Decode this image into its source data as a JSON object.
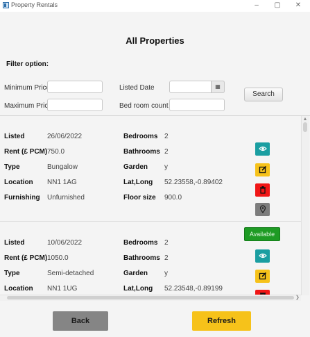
{
  "window": {
    "title": "Property Rentals",
    "min_glyph": "–",
    "max_glyph": "▢",
    "close_glyph": "✕"
  },
  "page": {
    "title": "All Properties",
    "filter_label": "Filter option:"
  },
  "filters": {
    "min_price_label": "Minimum Price",
    "max_price_label": "Maximum Price",
    "listed_date_label": "Listed Date",
    "bedroom_count_label": "Bed room count",
    "min_price_value": "",
    "max_price_value": "",
    "listed_date_value": "",
    "bedroom_count_value": "",
    "calendar_icon": "calendar-icon",
    "search_label": "Search"
  },
  "labels": {
    "listed": "Listed",
    "rent": "Rent (£ PCM)",
    "type": "Type",
    "location": "Location",
    "furnishing": "Furnishing",
    "bedrooms": "Bedrooms",
    "bathrooms": "Bathrooms",
    "garden": "Garden",
    "latlong": "Lat,Long",
    "floor_size": "Floor size"
  },
  "properties": [
    {
      "listed": "26/06/2022",
      "rent": "750.0",
      "type": "Bungalow",
      "location": "NN1 1AG",
      "furnishing": "Unfurnished",
      "bedrooms": "2",
      "bathrooms": "2",
      "garden": "y",
      "latlong": "52.23558,-0.89402",
      "floor_size": "900.0"
    },
    {
      "listed": "10/06/2022",
      "rent": "1050.0",
      "type": "Semi-detached",
      "location": "NN1 1UG",
      "bedrooms": "2",
      "bathrooms": "2",
      "garden": "y",
      "latlong": "52.23548,-0.89199",
      "availability": "Available"
    }
  ],
  "actions": {
    "view_icon": "eye-icon",
    "edit_icon": "edit-icon",
    "delete_icon": "trash-icon",
    "map_icon": "map-pin-icon"
  },
  "footer": {
    "back_label": "Back",
    "refresh_label": "Refresh"
  },
  "colors": {
    "teal": "#1a9ea1",
    "yellow": "#f6c21a",
    "red": "#f01616",
    "grey": "#7d7d7d",
    "available_green": "#1e9b24"
  }
}
